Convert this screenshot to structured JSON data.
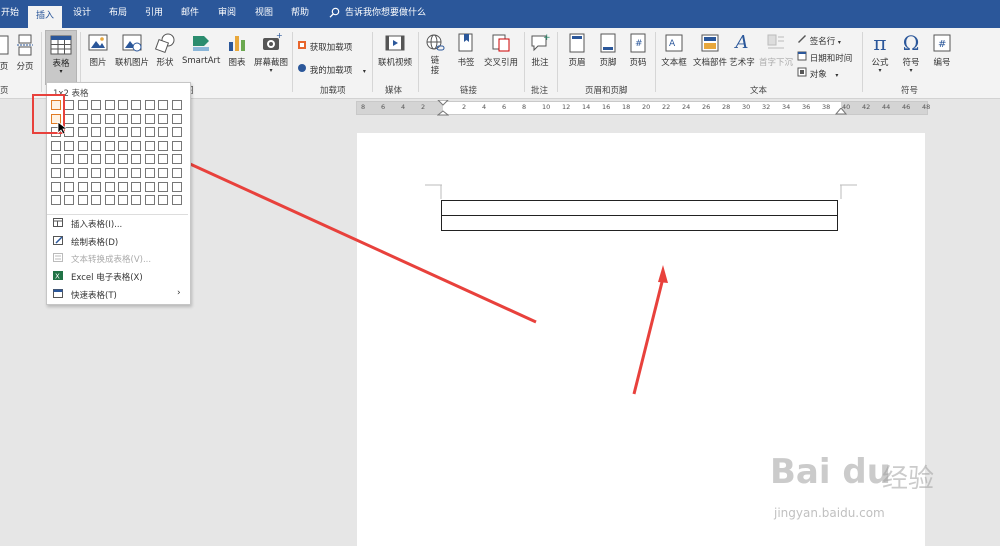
{
  "tabs": [
    {
      "label": "开始",
      "active": false
    },
    {
      "label": "插入",
      "active": true
    },
    {
      "label": "设计",
      "active": false
    },
    {
      "label": "布局",
      "active": false
    },
    {
      "label": "引用",
      "active": false
    },
    {
      "label": "邮件",
      "active": false
    },
    {
      "label": "审阅",
      "active": false
    },
    {
      "label": "视图",
      "active": false
    },
    {
      "label": "帮助",
      "active": false
    }
  ],
  "tell_me": "告诉我你想要做什么",
  "ribbon": {
    "buttons": {
      "page_partial": "页",
      "page_break": "分页",
      "table": "表格",
      "pictures": "图片",
      "online_pictures": "联机图片",
      "shapes": "形状",
      "smartart": "SmartArt",
      "chart": "图表",
      "screenshot": "屏幕截图",
      "get_addins": "获取加载项",
      "my_addins": "我的加载项",
      "online_video": "联机视频",
      "link": "链接",
      "bookmark": "书签",
      "cross_ref": "交叉引用",
      "comment": "批注",
      "header": "页眉",
      "footer": "页脚",
      "page_number": "页码",
      "textbox": "文本框",
      "quick_parts": "文档部件",
      "wordart": "艺术字",
      "dropcap": "首字下沉",
      "signature_line": "签名行",
      "date_time": "日期和时间",
      "object": "对象",
      "equation": "公式",
      "symbol": "符号",
      "number": "编号"
    },
    "groups": {
      "partial": "页",
      "illustrations": "图",
      "addins": "加载项",
      "media": "媒体",
      "links": "链接",
      "comments": "批注",
      "header_footer": "页眉和页脚",
      "text": "文本",
      "symbols": "符号"
    },
    "glyphs": {
      "pi": "π",
      "omega": "Ω",
      "hash": "#",
      "wordart_a": "A"
    }
  },
  "dropdown": {
    "header": "1x2 表格",
    "grid": {
      "cols": 10,
      "rows": 8,
      "selected_cols": 1,
      "selected_rows": 2
    },
    "items": [
      {
        "label": "插入表格(I)...",
        "disabled": false,
        "submenu": false
      },
      {
        "label": "绘制表格(D)",
        "disabled": false,
        "submenu": false
      },
      {
        "label": "文本转换成表格(V)...",
        "disabled": true,
        "submenu": false
      },
      {
        "label": "Excel 电子表格(X)",
        "disabled": false,
        "submenu": false
      },
      {
        "label": "快速表格(T)",
        "disabled": false,
        "submenu": true
      }
    ],
    "submenu_arrow": "›"
  },
  "ruler": {
    "numbers": [
      "8",
      "6",
      "4",
      "2",
      "2",
      "4",
      "6",
      "8",
      "10",
      "12",
      "14",
      "16",
      "18",
      "20",
      "22",
      "24",
      "26",
      "28",
      "30",
      "32",
      "34",
      "36",
      "38",
      "40",
      "42",
      "44",
      "46",
      "48"
    ]
  },
  "document": {
    "table": {
      "rows": 2,
      "cols": 1
    }
  },
  "watermark": {
    "brand": "Bai du",
    "cn": "经验",
    "url": "jingyan.baidu.com"
  },
  "colors": {
    "accent": "#2b579a",
    "annotation": "#e8413c",
    "selection": "#e07b24"
  }
}
